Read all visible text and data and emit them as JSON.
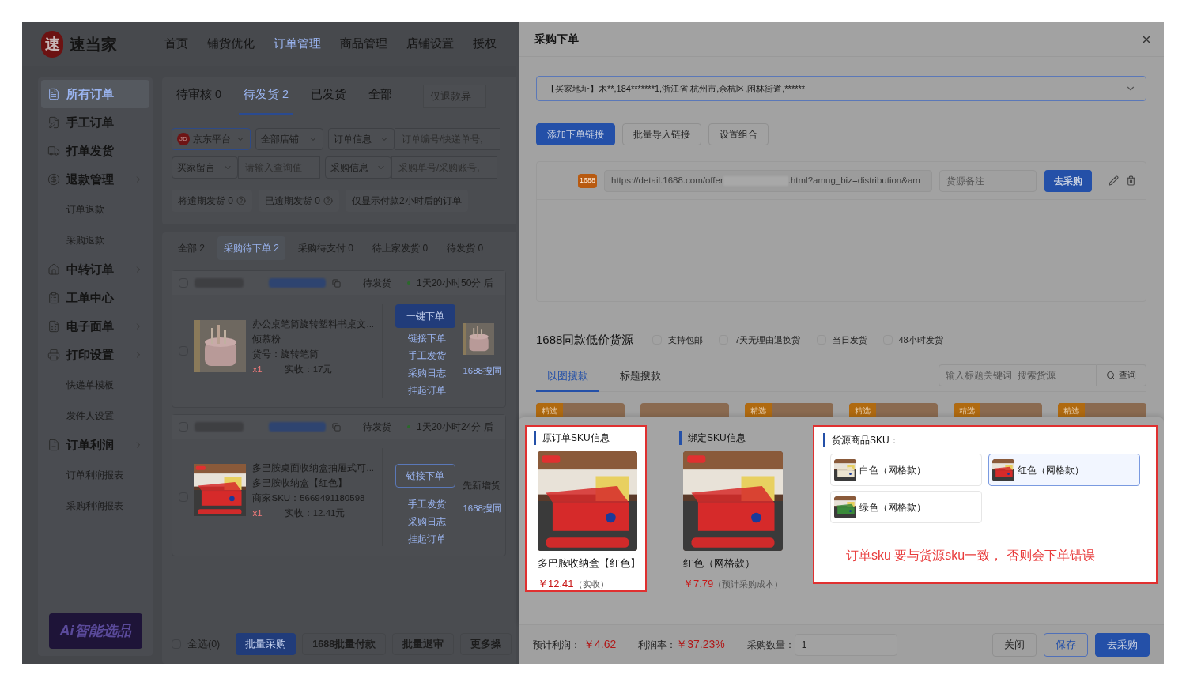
{
  "app": {
    "logo": "速",
    "brand": "速当家",
    "nav": [
      {
        "label": "首页",
        "selected": false
      },
      {
        "label": "铺货优化",
        "selected": false
      },
      {
        "label": "订单管理",
        "selected": true
      },
      {
        "label": "商品管理",
        "selected": false
      },
      {
        "label": "店铺设置",
        "selected": false
      },
      {
        "label": "授权",
        "selected": false
      }
    ]
  },
  "sidebar": {
    "items": [
      {
        "label": "所有订单",
        "selected": true,
        "expandable": false
      },
      {
        "label": "手工订单",
        "selected": false,
        "expandable": false
      },
      {
        "label": "打单发货",
        "selected": false,
        "expandable": false
      },
      {
        "label": "退款管理",
        "selected": false,
        "expandable": true,
        "children": [
          {
            "label": "订单退款",
            "selected": false
          },
          {
            "label": "采购退款",
            "selected": false
          }
        ]
      },
      {
        "label": "中转订单",
        "selected": false,
        "expandable": true
      },
      {
        "label": "工单中心",
        "selected": false,
        "expandable": false
      },
      {
        "label": "电子面单",
        "selected": false,
        "expandable": true
      },
      {
        "label": "打印设置",
        "selected": false,
        "expandable": true,
        "children": [
          {
            "label": "快递单模板",
            "selected": false
          },
          {
            "label": "发件人设置",
            "selected": false
          }
        ]
      },
      {
        "label": "订单利润",
        "selected": false,
        "expandable": true,
        "children": [
          {
            "label": "订单利润报表",
            "selected": false
          },
          {
            "label": "采购利润报表",
            "selected": false
          }
        ]
      }
    ],
    "banner": "Ai智能选品"
  },
  "status_tabs": [
    {
      "label": "待审核 0",
      "selected": false
    },
    {
      "label": "待发货 2",
      "selected": true
    },
    {
      "label": "已发货",
      "selected": false
    },
    {
      "label": "全部",
      "selected": false
    }
  ],
  "status_search": {
    "placeholder": "仅退款异"
  },
  "filters": {
    "platform": {
      "badge": "JD",
      "value": "京东平台"
    },
    "shop": "全部店铺",
    "order_info": {
      "select": "订单信息",
      "placeholder": "订单编号/快递单号,"
    },
    "buyer_note": {
      "select": "买家留言",
      "placeholder": "请输入查询值"
    },
    "purchase_info": {
      "select": "采购信息",
      "placeholder": "采购单号/采购账号,"
    }
  },
  "quick_filters": [
    {
      "label": "将逾期发货 0",
      "help": true
    },
    {
      "label": "已逾期发货 0",
      "help": true
    },
    {
      "label": "仅显示付款2小时后的订单",
      "help": false
    }
  ],
  "purchase_tabs": [
    {
      "label": "全部 2",
      "selected": false
    },
    {
      "label": "采购待下单 2",
      "selected": true
    },
    {
      "label": "采购待支付 0",
      "selected": false
    },
    {
      "label": "待上家发货 0",
      "selected": false
    },
    {
      "label": "待发货 0",
      "selected": false
    }
  ],
  "orders": [
    {
      "status": "待发货",
      "countdown": "1天20小时50分 后",
      "title": "办公桌笔筒旋转塑料书桌文...",
      "spec": "倾慕粉",
      "code": "货号：旋转笔筒",
      "qty": "x1",
      "received": "实收：17元",
      "checked": false,
      "item_checked": false,
      "actions": [
        {
          "label": "一键下单",
          "kind": "primary"
        },
        {
          "label": "链接下单",
          "kind": "link"
        },
        {
          "label": "手工发货",
          "kind": "link"
        },
        {
          "label": "采购日志",
          "kind": "link"
        },
        {
          "label": "挂起订单",
          "kind": "link"
        }
      ],
      "side_link": "1688搜同"
    },
    {
      "status": "待发货",
      "countdown": "1天20小时24分 后",
      "title": "多巴胺桌面收纳盒抽屉式可...",
      "spec": "多巴胺收纳盒【红色】",
      "code": "商家SKU：5669491180598",
      "qty": "x1",
      "received": "实收：12.41元",
      "checked": false,
      "item_checked": false,
      "actions": [
        {
          "label": "链接下单",
          "kind": "outline"
        },
        {
          "label": "手工发货",
          "kind": "link"
        },
        {
          "label": "采购日志",
          "kind": "link"
        },
        {
          "label": "挂起订单",
          "kind": "link"
        }
      ],
      "side_note": "先新增货",
      "side_link": "1688搜同"
    }
  ],
  "list_footer": {
    "select_all": "全选(0)",
    "checked": false,
    "buttons": [
      {
        "label": "批量采购",
        "kind": "primary"
      },
      {
        "label": "1688批量付款",
        "kind": "default"
      },
      {
        "label": "批量退审",
        "kind": "default"
      },
      {
        "label": "更多操",
        "kind": "default"
      }
    ]
  },
  "drawer": {
    "title": "采购下单",
    "address": "【买家地址】木**,184*******1,浙江省,杭州市,余杭区,闲林街道,******",
    "buttons": [
      {
        "label": "添加下单链接",
        "kind": "primary"
      },
      {
        "label": "批量导入链接",
        "kind": "default"
      },
      {
        "label": "设置组合",
        "kind": "default"
      }
    ],
    "link": {
      "badge": "1688",
      "url_start": "https://detail.1688.com/offer",
      "url_end": ".html?amug_biz=distribution&am",
      "remark_placeholder": "货源备注",
      "button": "去采购"
    },
    "source": {
      "title": "1688同款低价货源",
      "filters": [
        {
          "label": "支持包邮",
          "checked": false
        },
        {
          "label": "7天无理由退换货",
          "checked": false
        },
        {
          "label": "当日发货",
          "checked": false
        },
        {
          "label": "48小时发货",
          "checked": false
        }
      ],
      "tabs": [
        {
          "label": "以图搜款",
          "selected": true
        },
        {
          "label": "标题搜款",
          "selected": false
        }
      ],
      "search_placeholder": "输入标题关键词  搜索货源",
      "search_button": "查询",
      "results": [
        {
          "kind": "featured",
          "tag": "精选"
        },
        {
          "kind": "plain"
        },
        {
          "kind": "featured",
          "tag": "精选"
        },
        {
          "kind": "featured",
          "tag": "精选"
        },
        {
          "kind": "featured",
          "tag": "精选"
        },
        {
          "kind": "featured",
          "tag": "精选"
        }
      ]
    },
    "sku": {
      "original": {
        "title": "原订单SKU信息",
        "highlighted": true,
        "name": "多巴胺收纳盒【红色】",
        "price": "￥12.41",
        "price_note": "（实收）"
      },
      "bound": {
        "title": "绑定SKU信息",
        "name": "红色（网格款）",
        "price": "￥7.79",
        "price_note": "（预计采购成本）"
      },
      "source": {
        "title": "货源商品SKU：",
        "highlighted": true,
        "options": [
          {
            "label": "白色（网格款）",
            "selected": false
          },
          {
            "label": "红色（网格款）",
            "selected": true
          },
          {
            "label": "绿色（网格款）",
            "selected": false
          }
        ],
        "warning": "订单sku 要与货源sku一致， 否则会下单错误"
      }
    },
    "footer": {
      "profit_label": "预计利润：",
      "profit": "￥4.62",
      "rate_label": "利润率：",
      "rate": "￥37.23%",
      "qty_label": "采购数量：",
      "qty": "1",
      "buttons": [
        {
          "label": "关闭",
          "kind": "default"
        },
        {
          "label": "保存",
          "kind": "outline"
        },
        {
          "label": "去采购",
          "kind": "primary"
        }
      ]
    }
  }
}
